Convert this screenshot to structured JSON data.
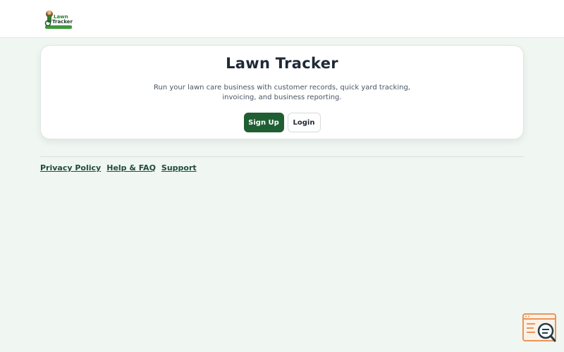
{
  "header": {
    "logo_text_line1": "Lawn",
    "logo_text_line2": "Tracker"
  },
  "hero": {
    "title": "Lawn Tracker",
    "description": "Run your lawn care business with customer records, quick yard tracking, invoicing, and business reporting.",
    "signup_label": "Sign Up",
    "login_label": "Login"
  },
  "footer": {
    "links": [
      {
        "label": "Privacy Policy"
      },
      {
        "label": "Help & FAQ"
      },
      {
        "label": "Support"
      }
    ]
  },
  "colors": {
    "page_background": "#f0f6f1",
    "primary_button": "#1f5e33",
    "link": "#1f4d3a",
    "widget_accent": "#e8965a"
  },
  "icons": {
    "logo": "lawn-tracker-logo-icon",
    "corner_widget": "search-feedback-widget-icon"
  }
}
